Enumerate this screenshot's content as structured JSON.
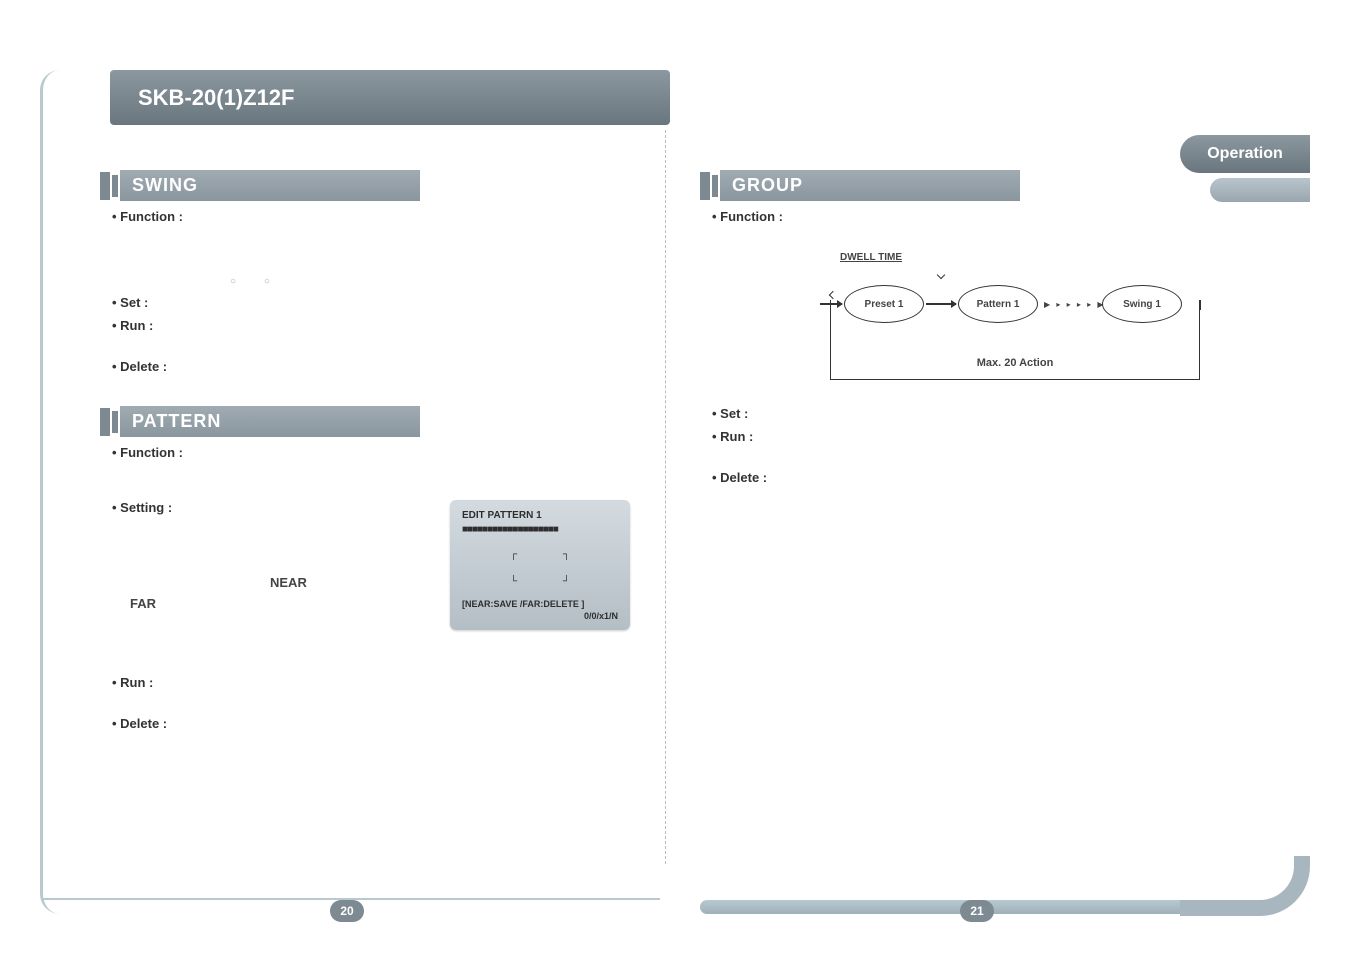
{
  "header": {
    "title": "SKB-20(1)Z12F"
  },
  "tab": {
    "operation": "Operation"
  },
  "swing": {
    "heading": "SWING",
    "function_label": "• Function :",
    "set_label": "• Set :",
    "run_label": "• Run :",
    "delete_label": "• Delete :"
  },
  "pattern": {
    "heading": "PATTERN",
    "function_label": "• Function :",
    "setting_label": "• Setting :",
    "near": "NEAR",
    "far": "FAR",
    "run_label": "• Run :",
    "delete_label": "• Delete :",
    "lcd": {
      "title": "EDIT PATTERN  1",
      "bar": "■■■■■■■■■■■■■■■■■■■",
      "c_tl": "┌",
      "c_tr": "┐",
      "c_bl": "└",
      "c_br": "┘",
      "foot": "[NEAR:SAVE    /FAR:DELETE ]",
      "foot2": "0/0/x1/N"
    }
  },
  "group": {
    "heading": "GROUP",
    "function_label": "• Function :",
    "set_label": "• Set :",
    "run_label": "• Run :",
    "delete_label": "• Delete :",
    "diagram": {
      "dwell": "DWELL TIME",
      "node1": "Preset   1",
      "node2": "Pattern   1",
      "node3": "Swing   1",
      "max": "Max. 20 Action"
    }
  },
  "pages": {
    "left": "20",
    "right": "21"
  }
}
